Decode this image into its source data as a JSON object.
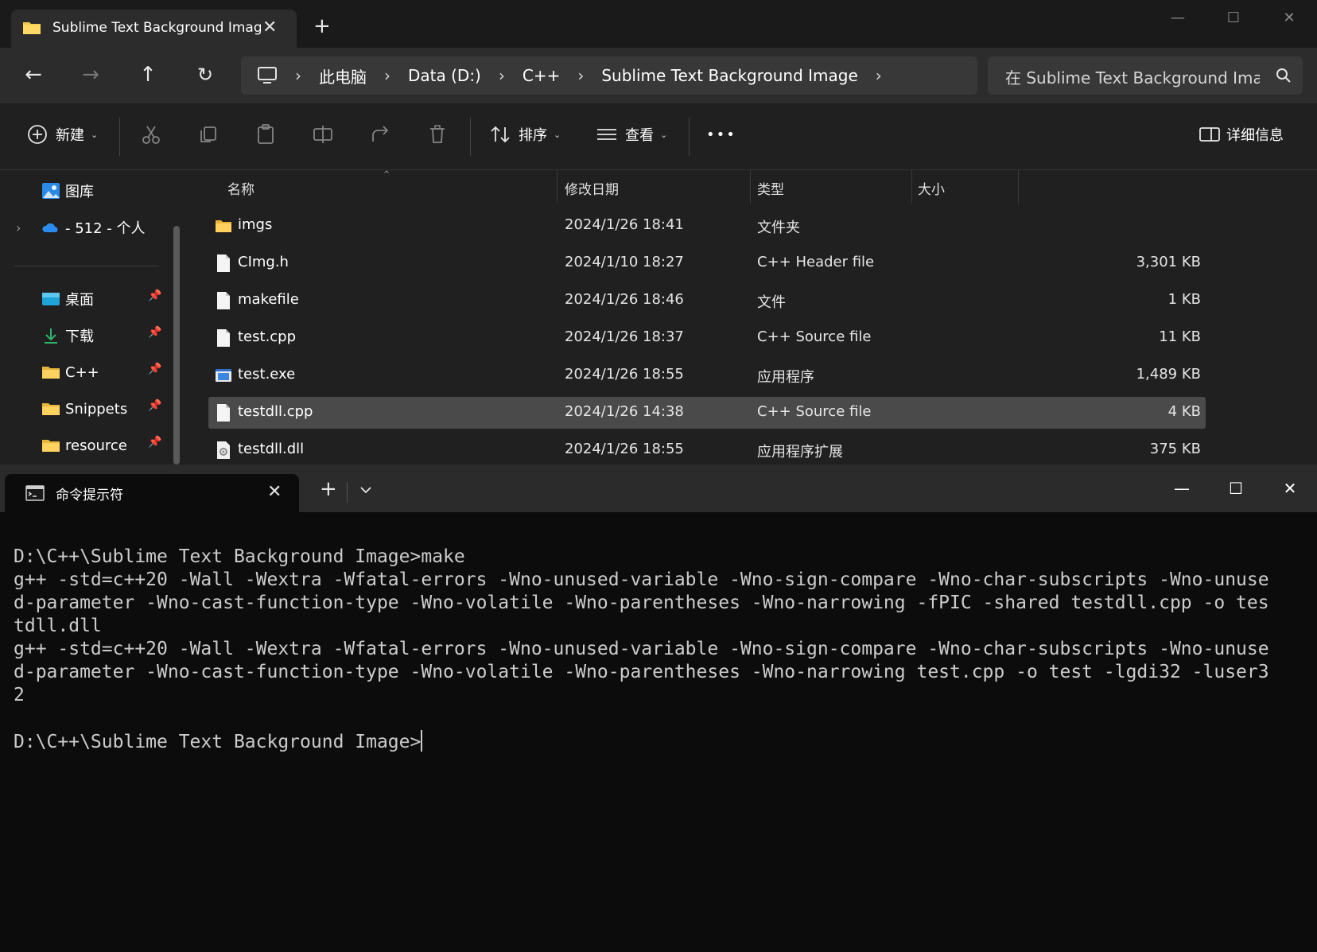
{
  "explorer": {
    "tab_title": "Sublime Text Background Image",
    "address": {
      "crumbs": [
        "此电脑",
        "Data (D:)",
        "C++",
        "Sublime Text Background Image"
      ]
    },
    "search_placeholder": "在 Sublime Text Background Image 中搜索",
    "toolbar": {
      "new_label": "新建",
      "sort_label": "排序",
      "view_label": "查看",
      "more_label": "•••",
      "details_label": "详细信息"
    },
    "sidebar": {
      "items": [
        {
          "label": "图库",
          "icon": "gallery-icon"
        },
        {
          "label": "- 512 - 个人",
          "icon": "onedrive-cloud-icon"
        },
        {
          "label": "桌面",
          "icon": "desktop-icon",
          "pinned": true
        },
        {
          "label": "下载",
          "icon": "download-icon",
          "pinned": true
        },
        {
          "label": "C++",
          "icon": "folder-icon",
          "pinned": true
        },
        {
          "label": "Snippets",
          "icon": "folder-icon",
          "pinned": true
        },
        {
          "label": "resource",
          "icon": "folder-icon",
          "pinned": true
        }
      ]
    },
    "columns": {
      "name": "名称",
      "date": "修改日期",
      "type": "类型",
      "size": "大小"
    },
    "files": [
      {
        "name": "imgs",
        "date": "2024/1/26 18:41",
        "type": "文件夹",
        "size": "",
        "icon": "folder-icon"
      },
      {
        "name": "CImg.h",
        "date": "2024/1/10 18:27",
        "type": "C++ Header file",
        "size": "3,301 KB",
        "icon": "file-icon"
      },
      {
        "name": "makefile",
        "date": "2024/1/26 18:46",
        "type": "文件",
        "size": "1 KB",
        "icon": "file-icon"
      },
      {
        "name": "test.cpp",
        "date": "2024/1/26 18:37",
        "type": "C++ Source file",
        "size": "11 KB",
        "icon": "file-icon"
      },
      {
        "name": "test.exe",
        "date": "2024/1/26 18:55",
        "type": "应用程序",
        "size": "1,489 KB",
        "icon": "exe-icon"
      },
      {
        "name": "testdll.cpp",
        "date": "2024/1/26 14:38",
        "type": "C++ Source file",
        "size": "4 KB",
        "icon": "file-icon",
        "selected": true
      },
      {
        "name": "testdll.dll",
        "date": "2024/1/26 18:55",
        "type": "应用程序扩展",
        "size": "375 KB",
        "icon": "dll-icon"
      }
    ]
  },
  "terminal": {
    "tab_title": "命令提示符",
    "lines": [
      "D:\\C++\\Sublime Text Background Image>make",
      "g++ -std=c++20 -Wall -Wextra -Wfatal-errors -Wno-unused-variable -Wno-sign-compare -Wno-char-subscripts -Wno-unuse",
      "d-parameter -Wno-cast-function-type -Wno-volatile -Wno-parentheses -Wno-narrowing -fPIC -shared testdll.cpp -o tes",
      "tdll.dll",
      "g++ -std=c++20 -Wall -Wextra -Wfatal-errors -Wno-unused-variable -Wno-sign-compare -Wno-char-subscripts -Wno-unuse",
      "d-parameter -Wno-cast-function-type -Wno-volatile -Wno-parentheses -Wno-narrowing test.cpp -o test -lgdi32 -luser3",
      "2",
      "",
      "D:\\C++\\Sublime Text Background Image>"
    ]
  },
  "colors": {
    "selection": "#4a4a4a",
    "folder": "#f2c94c",
    "terminal_text": "#cccccc",
    "terminal_bg": "#0c0c0c"
  }
}
